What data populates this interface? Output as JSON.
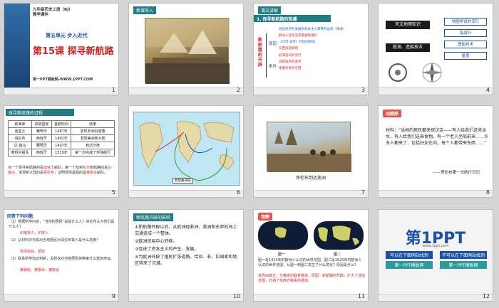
{
  "slides": [
    {
      "num": "1",
      "header_line1": "九年级历史上册（RJ）",
      "header_line2": "教学课件",
      "unit": "第五单元  步入近代",
      "title": "第15课 探寻新航路",
      "footer": "第一PPT模板网-WWW.1PPT.COM"
    },
    {
      "num": "2",
      "tag": "新课导入"
    },
    {
      "num": "3",
      "tag": "课文讲解",
      "heading": "1. 探寻新航路的热潮",
      "vertical_label": "新航路的开辟",
      "bracket_label": "原因",
      "bracket_label2": "条件",
      "items": [
        "商品经济的发展和资本主义萌芽的出现（根源）",
        "欧洲人狂热追求黄金和香料",
        "《马可·波罗》行纪的影响",
        "东西商道受阻",
        "航海资讯的流行",
        "造船技术的进步",
        "指南针等的应用"
      ]
    },
    {
      "num": "4",
      "left_top": "天文地理知识",
      "left_bottom": "航海、造船技术",
      "right_items": [
        "地圆学说的流行",
        "指南针",
        "造船技术",
        "星盘"
      ]
    },
    {
      "num": "5",
      "tag": "探寻新航路的过程",
      "table_header": [
        "航海家",
        "资助国家",
        "首航时间",
        "结果"
      ],
      "table_rows": [
        [
          "迪亚士",
          "葡萄牙",
          "1487年",
          "发现非洲好望角"
        ],
        [
          "哥伦布",
          "西班牙",
          "1492年",
          "发现美洲新大陆"
        ],
        [
          "达·伽马",
          "葡萄牙",
          "1497年",
          "到达印度"
        ],
        [
          "麦哲伦船队",
          "西班牙",
          "1519年",
          "第一次完成了环球航行"
        ]
      ],
      "text_1": "在一个探寻新航路的是",
      "hl_1": "迪亚士",
      "text_2": "船队，第一个找到",
      "hl_2": "东方",
      "text_3": "新航路的是",
      "hl_3": "达·伽马",
      "text_4": "，发现新大陆的是",
      "hl_4": "哥伦布",
      "text_5": "，证明地球是圆的是",
      "hl_5": "麦哲伦",
      "text_6": "船队。"
    },
    {
      "num": "6",
      "map_label": "新航路开辟"
    },
    {
      "num": "7",
      "caption": "哥伦布到达美洲"
    },
    {
      "num": "8",
      "tag": "动脑筋",
      "quote": "材料：“当地的居民都来探访这——有人给我们送来淡水，有人给我们送来食物。有一个老人坐船前来……许多人都来了，包括妇女在内，每个人都带来东西……”",
      "source": "——哥伦布第一次航行日记"
    },
    {
      "num": "9",
      "tag": "回答下列问题",
      "q1": "（1）根据所学内容，“当地的居民”是指什么人？哥伦布认为他们是什么人？",
      "a1": "印第安人，印度人",
      "q2": "（2）从材料中可看出当地居民对哥伦布等人是什么态度？",
      "a2": "热情欢迎，帮助",
      "q3": "（3）联系所学知识判断，设想这对当地居民将带来什么样的命运。",
      "a3": "被剥削、被屠杀、被奴役"
    },
    {
      "num": "10",
      "tag": "新航路开辟的影响",
      "items": [
        "①新航路开辟以后，从欧洲经非洲、美洲和东亚的海上交通连成一个整体。",
        "②欧洲贸易中心转移。",
        "③促进了资本主义的产生、发展。",
        "④为欧洲开辟了殖民扩张道路，给亚、非、拉国家和地区带来了灾难。"
      ]
    },
    {
      "num": "11",
      "tag": "观察",
      "label_a": "图一",
      "label_b": "图二",
      "text": "图一是1420年时欧洲人认识的世界范围，图二是1620年时欧洲人认识的世界范围。从图一到图二发生了什么变化？原因是什么？",
      "answer": "世界由孤立、分散走向联系整体。原因：新航路的开辟，扩大了活动范围，打通了东西方联系的通道。"
    },
    {
      "num": "12",
      "brand": "第1PPT",
      "url": "www.1ppt.com",
      "btn1": "可以在下面网站找到",
      "btn2": "不可以在下面网站找到",
      "btn3": "第一PPT模板网",
      "btn4": "第一PPT模板网"
    }
  ],
  "colors": {
    "teal": "#2c9a9a",
    "red": "#d72020",
    "blue": "#1b4fa8"
  }
}
